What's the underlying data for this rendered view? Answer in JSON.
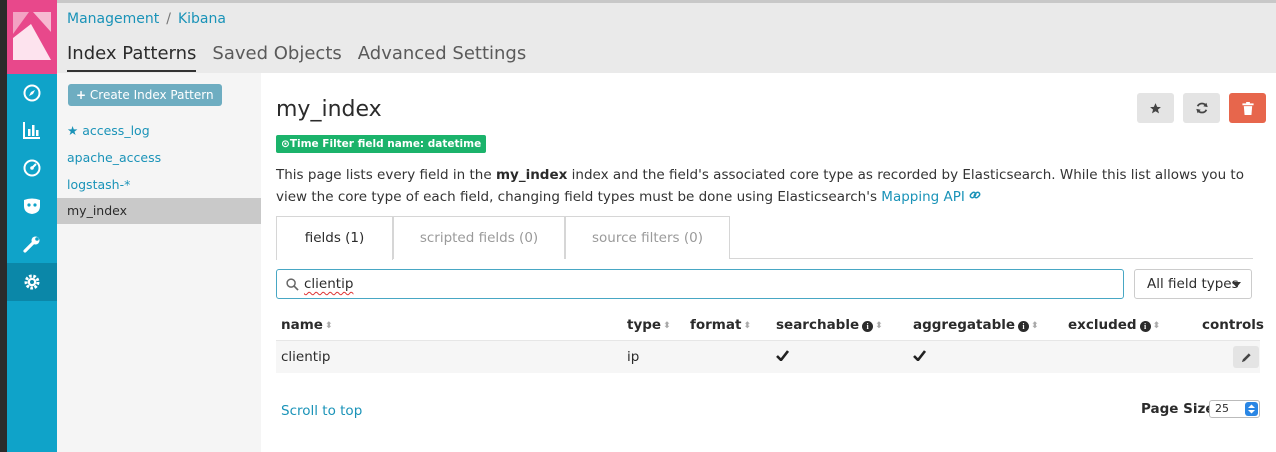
{
  "breadcrumb": {
    "root": "Management",
    "separator": "/",
    "current": "Kibana"
  },
  "tabs": [
    {
      "label": "Index Patterns",
      "active": true
    },
    {
      "label": "Saved Objects",
      "active": false
    },
    {
      "label": "Advanced Settings",
      "active": false
    }
  ],
  "sidebar": {
    "icons": [
      "compass-icon",
      "bar-chart-icon",
      "dashboard-gauge-icon",
      "timelion-mask-icon",
      "wrench-icon",
      "gear-icon"
    ],
    "active_icon": "gear-icon",
    "accent": "#0fa3c9",
    "logo_color": "#e8488b"
  },
  "index_list": {
    "create_label": "Create Index Pattern",
    "items": [
      {
        "label": "access_log",
        "default": true
      },
      {
        "label": "apache_access",
        "default": false
      },
      {
        "label": "logstash-*",
        "default": false
      },
      {
        "label": "my_index",
        "selected": true
      }
    ]
  },
  "main": {
    "title": "my_index",
    "time_filter_badge": "Time Filter field name: datetime",
    "description": {
      "part1": "This page lists every field in the",
      "bold": "my_index",
      "part2": "index and the field's associated core type as recorded by Elasticsearch. While this list allows you to view the core type of each field, changing field types must be done using Elasticsearch's",
      "link": "Mapping API"
    },
    "field_tabs": [
      "fields (1)",
      "scripted fields (0)",
      "source filters (0)"
    ],
    "search": {
      "value": "clientip"
    },
    "type_filter": "All field types",
    "columns": [
      "name",
      "type",
      "format",
      "searchable",
      "aggregatable",
      "excluded",
      "controls"
    ],
    "rows": [
      {
        "name": "clientip",
        "type": "ip",
        "format": "",
        "searchable": true,
        "aggregatable": true,
        "excluded": false
      }
    ],
    "scroll_to_top": "Scroll to top",
    "page_size_label": "Page Size",
    "page_size": "25"
  },
  "colors": {
    "link": "#1a93b8",
    "badge": "#1bb36b",
    "danger": "#e7664c"
  }
}
